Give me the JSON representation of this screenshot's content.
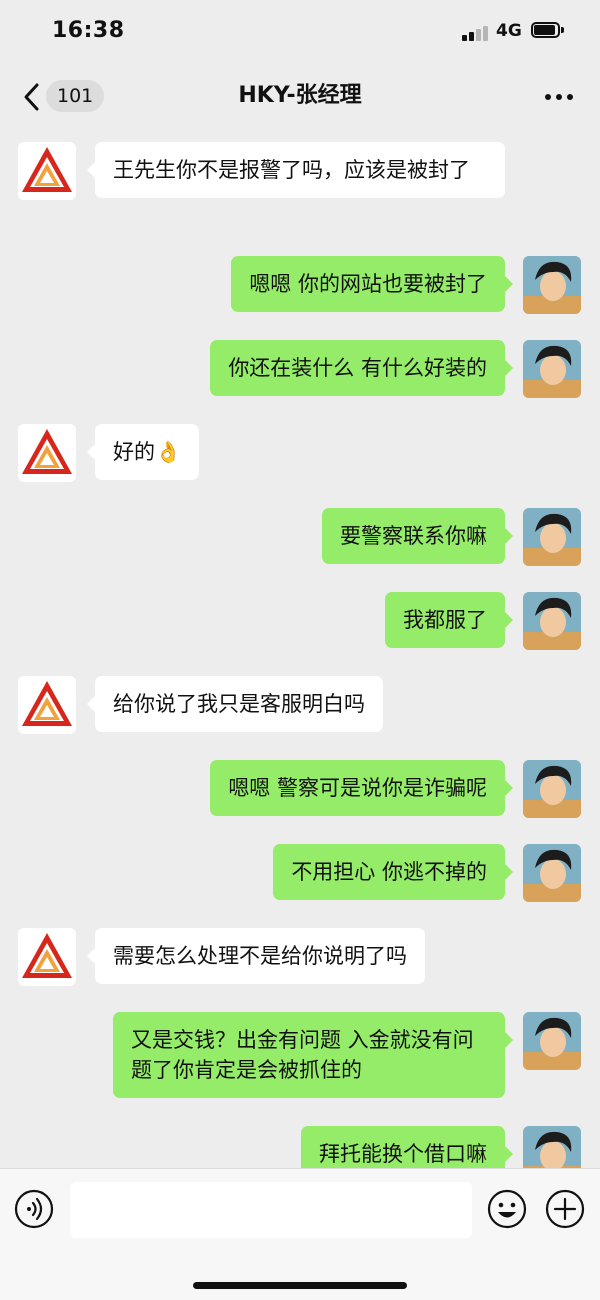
{
  "status": {
    "time": "16:38",
    "network": "4G"
  },
  "nav": {
    "unread_count": "101",
    "title": "HKY-张经理"
  },
  "messages": [
    {
      "side": "in",
      "text": "王先生你不是报警了吗，应该是被封了"
    },
    {
      "side": "out",
      "text": "嗯嗯 你的网站也要被封了"
    },
    {
      "side": "out",
      "text": "你还在装什么 有什么好装的"
    },
    {
      "side": "in",
      "text": "好的👌"
    },
    {
      "side": "out",
      "text": "要警察联系你嘛"
    },
    {
      "side": "out",
      "text": "我都服了"
    },
    {
      "side": "in",
      "text": "给你说了我只是客服明白吗"
    },
    {
      "side": "out",
      "text": "嗯嗯 警察可是说你是诈骗呢"
    },
    {
      "side": "out",
      "text": "不用担心 你逃不掉的"
    },
    {
      "side": "in",
      "text": "需要怎么处理不是给你说明了吗"
    },
    {
      "side": "out",
      "text": "又是交钱？出金有问题 入金就没有问题了你肯定是会被抓住的"
    },
    {
      "side": "out",
      "text": "拜托能换个借口嘛"
    }
  ],
  "input": {
    "placeholder": ""
  },
  "colors": {
    "background": "#ededed",
    "outgoing_bubble": "#95ec69",
    "incoming_bubble": "#ffffff",
    "logo_red": "#d7261c",
    "logo_orange": "#f2a23c"
  }
}
